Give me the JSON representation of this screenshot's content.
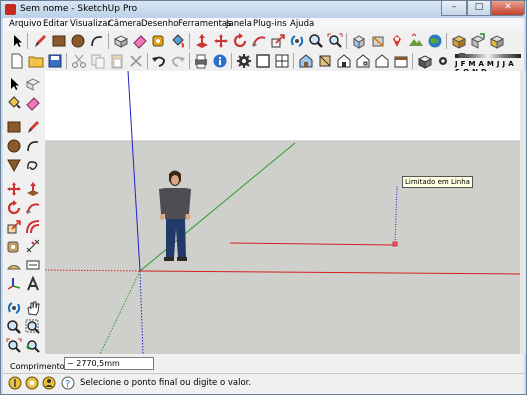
{
  "window": {
    "title": "Sem nome - SketchUp Pro"
  },
  "menu": [
    "Arquivo",
    "Editar",
    "Visualizar",
    "Câmera",
    "Desenho",
    "Ferramentas",
    "Janela",
    "Plug-ins",
    "Ajuda"
  ],
  "shadow_months": "J F M A M J J A S O N D",
  "viewport": {
    "inference_tooltip": "Limitado em Linha"
  },
  "measurements": {
    "label": "Comprimento",
    "value": "~ 2770,5mm"
  },
  "status": {
    "message": "Selecione o ponto final ou digite o valor."
  },
  "colors": {
    "red_axis": "#d42020",
    "green_axis": "#2b9a2b",
    "blue_axis": "#2222c8",
    "ground": "#cfcfcc",
    "sky": "#ffffff"
  }
}
